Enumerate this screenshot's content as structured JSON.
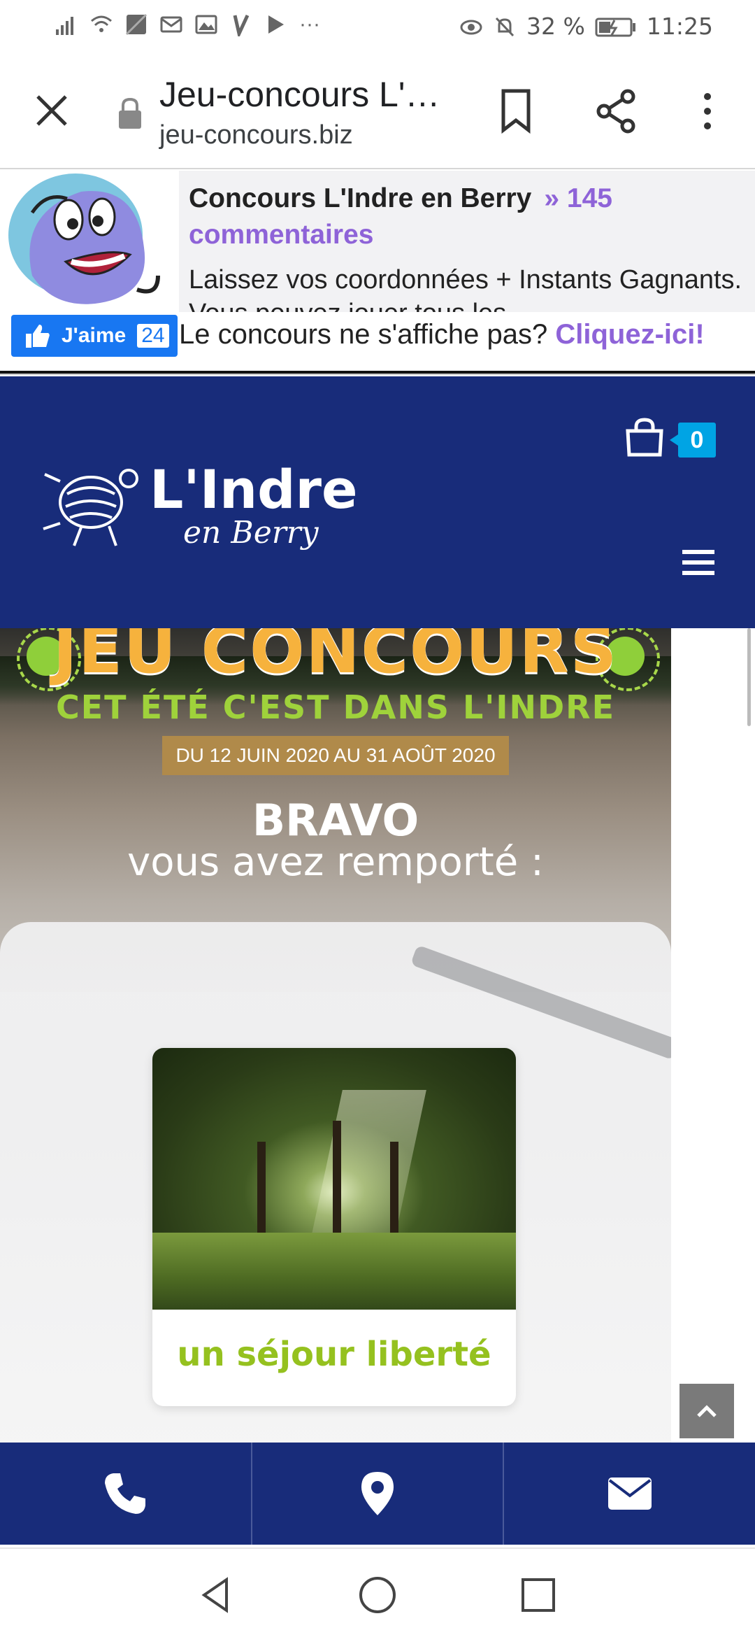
{
  "status_bar": {
    "battery": "32 %",
    "time": "11:25"
  },
  "toolbar": {
    "title": "Jeu-concours L'…",
    "url": "jeu-concours.biz"
  },
  "promo": {
    "title": "Concours L'Indre en Berry",
    "comments": "» 145 commentaires",
    "description": "Laissez vos coordonnées + Instants Gagnants. Vous pouvez jouer tous les",
    "like_label": "J'aime",
    "like_count": "24",
    "note": "Le concours ne s'affiche pas?",
    "note_link": "Cliquez-ici!"
  },
  "site_header": {
    "logo_main": "L'Indre",
    "logo_sub": "en Berry",
    "cart_count": "0"
  },
  "banner": {
    "headline": "JEU CONCOURS",
    "subheadline": "CET ÉTÉ C'EST DANS L'INDRE",
    "dates": "DU 12 JUIN 2020 AU 31 AOÛT 2020",
    "bravo": "BRAVO",
    "won_text": "vous avez remporté :",
    "prize": "un séjour liberté"
  },
  "colors": {
    "brand_blue": "#182c7a",
    "accent_purple": "#8e63d8",
    "facebook_blue": "#1877f2",
    "badge_cyan": "#00a4e4",
    "prize_green": "#95c11f",
    "headline_yellow": "#f6b23d"
  },
  "icons": {
    "contact_bar": [
      "phone-icon",
      "map-pin-icon",
      "envelope-icon"
    ],
    "nav": [
      "back-triangle-icon",
      "home-circle-icon",
      "recents-square-icon"
    ]
  }
}
